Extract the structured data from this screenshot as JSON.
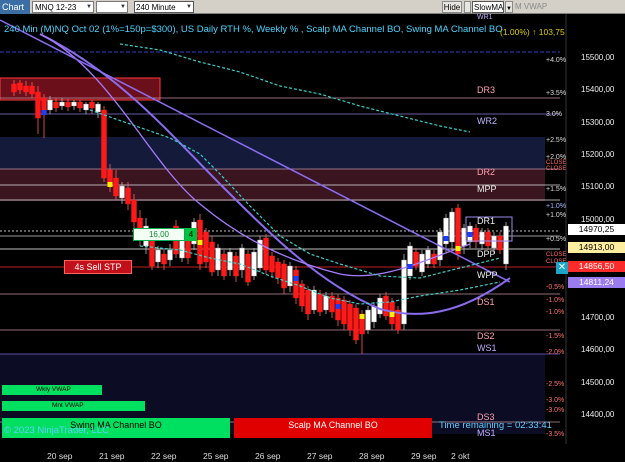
{
  "toolbar": {
    "tab": "Chart",
    "instrument": "MNQ 12-23",
    "interval": "240 Minute",
    "hide": "Hide",
    "strategy": "SlowMA",
    "indicator": "M VWAP"
  },
  "chart": {
    "title": "240 Min (M)NQ Oct 02 (1%=150p=$300), US Daily RTH %, Weekly % , Scalp MA Channel BO, Swing MA Channel BO",
    "title_right": "(1.00%) ↑ 103,75",
    "percent_labels": [
      {
        "text": "+4.0%",
        "kind": "pos"
      },
      {
        "text": "+3.5%",
        "kind": "pos"
      },
      {
        "text": "3.0%",
        "kind": "pos"
      },
      {
        "text": "+2.5%",
        "kind": "pos"
      },
      {
        "text": "+2.0%",
        "kind": "pos"
      },
      {
        "text": "+1.5%",
        "kind": "pos"
      },
      {
        "text": "+1.0%",
        "kind": "blue"
      },
      {
        "text": "+1.0%",
        "kind": "pos"
      },
      {
        "text": "+0.5%",
        "kind": "pos"
      },
      {
        "text": "-0.5%",
        "kind": "neg"
      },
      {
        "text": "-1.0%",
        "kind": "neg"
      },
      {
        "text": "-1.0%",
        "kind": "neg"
      },
      {
        "text": "-1.5%",
        "kind": "neg"
      },
      {
        "text": "-2.0%",
        "kind": "neg"
      },
      {
        "text": "-2.5%",
        "kind": "neg"
      },
      {
        "text": "-3.0%",
        "kind": "neg"
      },
      {
        "text": "-3.0%",
        "kind": "neg"
      },
      {
        "text": "-3.5%",
        "kind": "neg"
      }
    ],
    "price_labels": [
      "15500,00",
      "15400,00",
      "15300,00",
      "15200,00",
      "15100,00",
      "15000,00",
      "14700,00",
      "14600,00",
      "14500,00",
      "14400,00"
    ],
    "price_badges": [
      {
        "text": "14970,25",
        "bg": "#ffffff"
      },
      {
        "text": "14913,00",
        "bg": "#ffeea0"
      },
      {
        "text": "14856,50",
        "bg": "#ff2b2b"
      },
      {
        "text": "14811,24",
        "bg": "#9b7cf0"
      }
    ],
    "levels": [
      {
        "text": "DR3",
        "kind": "pink"
      },
      {
        "text": "WR2",
        "kind": "purple"
      },
      {
        "text": "DR2",
        "kind": "pink"
      },
      {
        "text": "MPP",
        "kind": "white"
      },
      {
        "text": "DR1",
        "kind": "white"
      },
      {
        "text": "DPP",
        "kind": "white"
      },
      {
        "text": "WPP",
        "kind": "white"
      },
      {
        "text": "DS1",
        "kind": "pink"
      },
      {
        "text": "DS2",
        "kind": "pink"
      },
      {
        "text": "WS1",
        "kind": "purple"
      },
      {
        "text": "DS3",
        "kind": "pink"
      },
      {
        "text": "MS1",
        "kind": "purple"
      },
      {
        "text": "WR1",
        "kind": "purple"
      }
    ],
    "close_marks": [
      "CLOSE",
      "CLOSE",
      "CLOSE",
      "CLOSE"
    ],
    "x_axis_dates": [
      "20 sep",
      "21 sep",
      "22 sep",
      "25 sep",
      "26 sep",
      "27 sep",
      "28 sep",
      "29 sep",
      "2 okt"
    ],
    "order": {
      "sell_label": "4s  Sell STP",
      "entry_price": "16,00",
      "quantity": "4",
      "close_symbol": "✕"
    },
    "panels": [
      "Wkly VWAP",
      "Mnt VWAP",
      "Swing MA Channel BO",
      "Scalp MA Channel BO"
    ],
    "copyright": "© 2023 NinjaTrader, LLC",
    "time_remaining": "Time remaining = 02:33:41",
    "colors": {
      "bull": "#ffffff",
      "bear": "#ff1a1a",
      "ma_slow": "#8a6cf0",
      "channel": "#38d0c8",
      "zone_red": "#3a1520",
      "zone_blue": "#141a3a"
    }
  }
}
